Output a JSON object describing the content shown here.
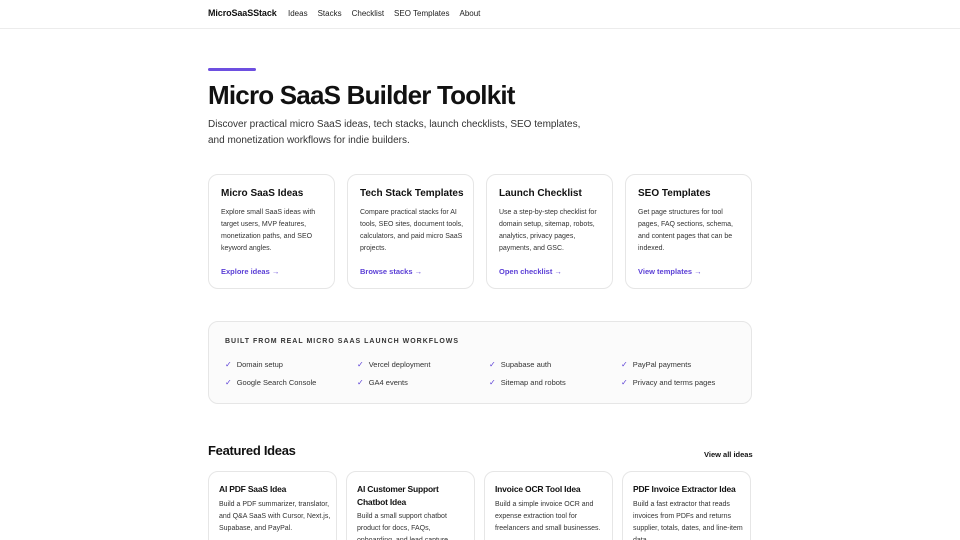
{
  "nav": {
    "brand": "MicroSaaSStack",
    "links": [
      "Ideas",
      "Stacks",
      "Checklist",
      "SEO Templates",
      "About"
    ]
  },
  "hero": {
    "title": "Micro SaaS Builder Toolkit",
    "subtitle": "Discover practical micro SaaS ideas, tech stacks, launch checklists, SEO templates, and monetization workflows for indie builders."
  },
  "cards": [
    {
      "title": "Micro SaaS Ideas",
      "desc": "Explore small SaaS ideas with target users, MVP features, monetization paths, and SEO keyword angles.",
      "link": "Explore ideas →"
    },
    {
      "title": "Tech Stack Templates",
      "desc": "Compare practical stacks for AI tools, SEO sites, document tools, calculators, and paid micro SaaS projects.",
      "link": "Browse stacks →"
    },
    {
      "title": "Launch Checklist",
      "desc": "Use a step-by-step checklist for domain setup, sitemap, robots, analytics, privacy pages, payments, and GSC.",
      "link": "Open checklist →"
    },
    {
      "title": "SEO Templates",
      "desc": "Get page structures for tool pages, FAQ sections, schema, and content pages that can be indexed.",
      "link": "View templates →"
    }
  ],
  "built": {
    "title": "BUILT FROM REAL MICRO SAAS LAUNCH WORKFLOWS",
    "items": [
      "Domain setup",
      "Vercel deployment",
      "Supabase auth",
      "PayPal payments",
      "Google Search Console",
      "GA4 events",
      "Sitemap and robots",
      "Privacy and terms pages"
    ]
  },
  "featured": {
    "title": "Featured Ideas",
    "view_all": "View all ideas",
    "cards": [
      {
        "title": "AI PDF SaaS Idea",
        "desc": "Build a PDF summarizer, translator, and Q&A SaaS with Cursor, Next.js, Supabase, and PayPal."
      },
      {
        "title": "AI Customer Support Chatbot Idea",
        "desc": "Build a small support chatbot product for docs, FAQs, onboarding, and lead capture."
      },
      {
        "title": "Invoice OCR Tool Idea",
        "desc": "Build a simple invoice OCR and expense extraction tool for freelancers and small businesses."
      },
      {
        "title": "PDF Invoice Extractor Idea",
        "desc": "Build a fast extractor that reads invoices from PDFs and returns supplier, totals, dates, and line-item data."
      }
    ]
  }
}
